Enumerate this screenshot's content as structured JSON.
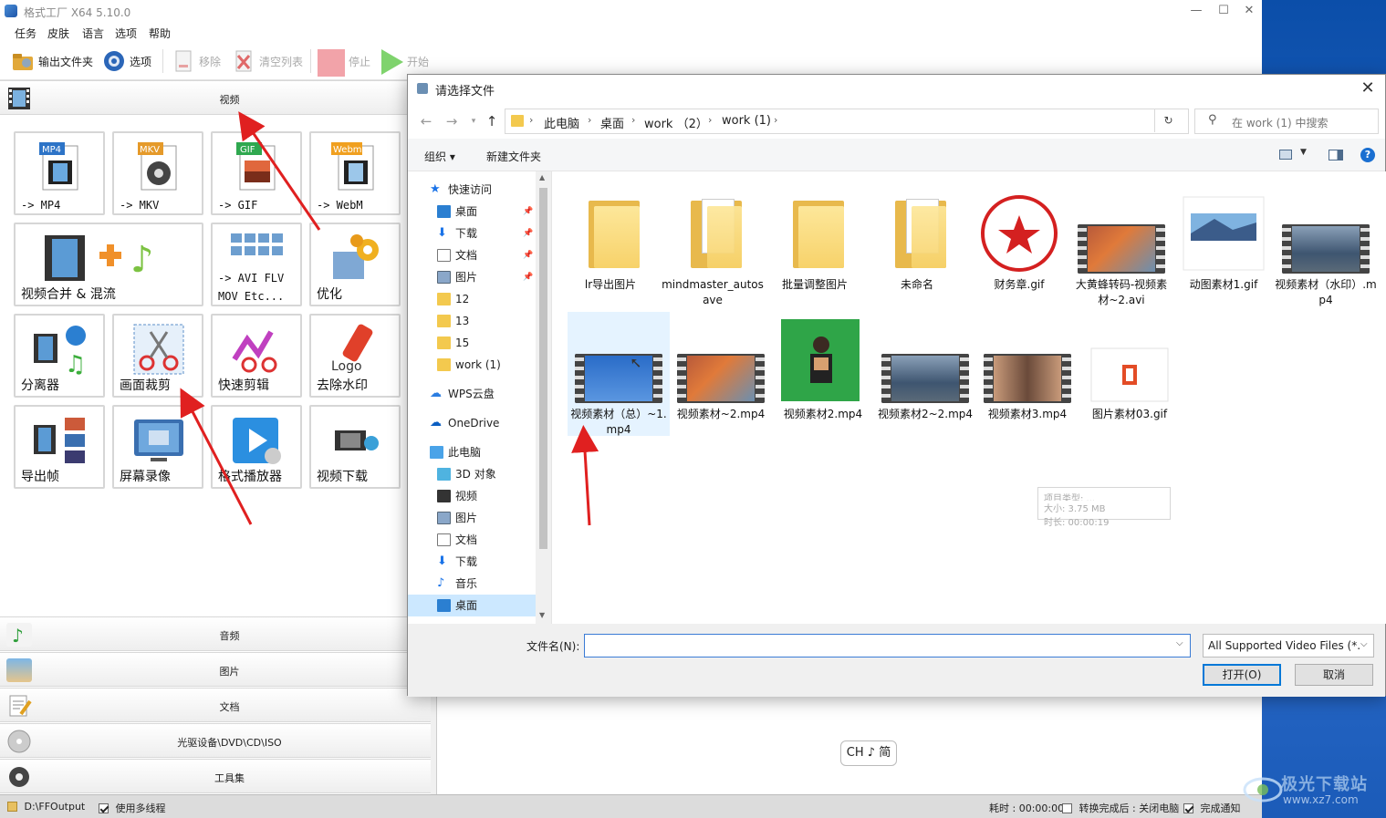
{
  "app": {
    "title": "格式工厂 X64 5.10.0",
    "menu": [
      "任务",
      "皮肤",
      "语言",
      "选项",
      "帮助"
    ],
    "toolbar": {
      "output_folder": "输出文件夹",
      "options": "选项",
      "remove": "移除",
      "clear_list": "清空列表",
      "stop": "停止",
      "start": "开始"
    },
    "categories": {
      "video": "视频",
      "audio": "音频",
      "image": "图片",
      "document": "文档",
      "optical": "光驱设备\\DVD\\CD\\ISO",
      "tools": "工具集"
    },
    "tiles": [
      {
        "label": "-> MP4",
        "badge": "MP4",
        "icon": "mp4-video-icon"
      },
      {
        "label": "-> MKV",
        "badge": "MKV",
        "icon": "mkv-video-icon"
      },
      {
        "label": "-> GIF",
        "badge": "GIF",
        "icon": "gif-image-icon"
      },
      {
        "label": "-> WebM",
        "badge": "Webm",
        "icon": "webm-video-icon"
      },
      {
        "label": "视频合并 & 混流",
        "icon": "video-merge-icon"
      },
      {
        "label": "-> AVI FLV\nMOV Etc...",
        "line1": "-> AVI FLV",
        "line2": "MOV Etc...",
        "icon": "format-list-icon"
      },
      {
        "label": "优化",
        "icon": "optimize-gear-icon"
      },
      {
        "label": "分离器",
        "icon": "splitter-icon"
      },
      {
        "label": "画面裁剪",
        "icon": "crop-scissors-icon"
      },
      {
        "label": "快速剪辑",
        "icon": "quick-edit-icon"
      },
      {
        "label": "去除水印",
        "badge": "Logo",
        "icon": "remove-watermark-icon"
      },
      {
        "label": "导出帧",
        "icon": "export-frames-icon"
      },
      {
        "label": "屏幕录像",
        "icon": "screen-record-icon"
      },
      {
        "label": "格式播放器",
        "icon": "player-icon"
      },
      {
        "label": "视频下载",
        "icon": "video-download-icon"
      }
    ],
    "ime": "CH ♪ 简",
    "status": {
      "output_path": "D:\\FFOutput",
      "multithread": "使用多线程",
      "elapsed": "耗时 : 00:00:00",
      "after_convert": "转换完成后 : 关闭电脑",
      "notify": "完成通知"
    }
  },
  "dialog": {
    "title": "请选择文件",
    "breadcrumbs": [
      "此电脑",
      "桌面",
      "work （2）",
      "work (1)"
    ],
    "search_placeholder": "在 work (1) 中搜索",
    "commands": {
      "organize": "组织 ▾",
      "new_folder": "新建文件夹"
    },
    "nav": [
      {
        "label": "快速访问",
        "icon": "star-icon",
        "pinned": false
      },
      {
        "label": "桌面",
        "icon": "desktop-icon",
        "pinned": true
      },
      {
        "label": "下载",
        "icon": "download-icon",
        "pinned": true
      },
      {
        "label": "文档",
        "icon": "document-icon",
        "pinned": true
      },
      {
        "label": "图片",
        "icon": "pictures-icon",
        "pinned": true
      },
      {
        "label": "12",
        "icon": "folder-icon",
        "pinned": false
      },
      {
        "label": "13",
        "icon": "folder-icon",
        "pinned": false
      },
      {
        "label": "15",
        "icon": "folder-icon",
        "pinned": false
      },
      {
        "label": "work (1)",
        "icon": "folder-icon",
        "pinned": false
      },
      {
        "label": "WPS云盘",
        "icon": "cloud-icon",
        "pinned": false
      },
      {
        "label": "OneDrive",
        "icon": "onedrive-icon",
        "pinned": false
      },
      {
        "label": "此电脑",
        "icon": "computer-icon",
        "pinned": false
      },
      {
        "label": "3D 对象",
        "icon": "cube-icon",
        "pinned": false
      },
      {
        "label": "视频",
        "icon": "video-icon",
        "pinned": false
      },
      {
        "label": "图片",
        "icon": "pictures-icon",
        "pinned": false
      },
      {
        "label": "文档",
        "icon": "document-icon",
        "pinned": false
      },
      {
        "label": "下载",
        "icon": "download-icon",
        "pinned": false
      },
      {
        "label": "音乐",
        "icon": "music-icon",
        "pinned": false
      },
      {
        "label": "桌面",
        "icon": "desktop-icon",
        "pinned": false
      }
    ],
    "files": [
      {
        "name": "lr导出图片",
        "kind": "folder"
      },
      {
        "name": "mindmaster_autosave",
        "kind": "folder-docs"
      },
      {
        "name": "批量调整图片",
        "kind": "folder"
      },
      {
        "name": "未命名",
        "kind": "folder-docs"
      },
      {
        "name": "财务章.gif",
        "kind": "stamp"
      },
      {
        "name": "大黄蜂转码-视频素材~2.avi",
        "kind": "video-leaves"
      },
      {
        "name": "动图素材1.gif",
        "kind": "image-mountain"
      },
      {
        "name": "视频素材（水印）.mp4",
        "kind": "video-city"
      },
      {
        "name": "视频素材（总）~1.mp4",
        "kind": "video-sky"
      },
      {
        "name": "视频素材~2.mp4",
        "kind": "video-leaves"
      },
      {
        "name": "视频素材2.mp4",
        "kind": "image-person"
      },
      {
        "name": "视频素材2~2.mp4",
        "kind": "video-city"
      },
      {
        "name": "视频素材3.mp4",
        "kind": "video-glasses"
      },
      {
        "name": "图片素材03.gif",
        "kind": "image-office"
      }
    ],
    "tooltip": {
      "line1": "项目类型: ...",
      "line2": "大小: 3.75 MB",
      "line3": "时长: 00:00:19"
    },
    "filename_label": "文件名(N):",
    "filename_value": "",
    "filetype": "All Supported Video Files (*.",
    "open_button": "打开(O)",
    "cancel_button": "取消"
  },
  "watermark": {
    "line1": "极光下载站",
    "line2": "www.xz7.com"
  },
  "colors": {
    "accent": "#0078d7",
    "selection": "#cce8ff",
    "hover": "#e5f3ff",
    "arrow": "#e02020"
  }
}
